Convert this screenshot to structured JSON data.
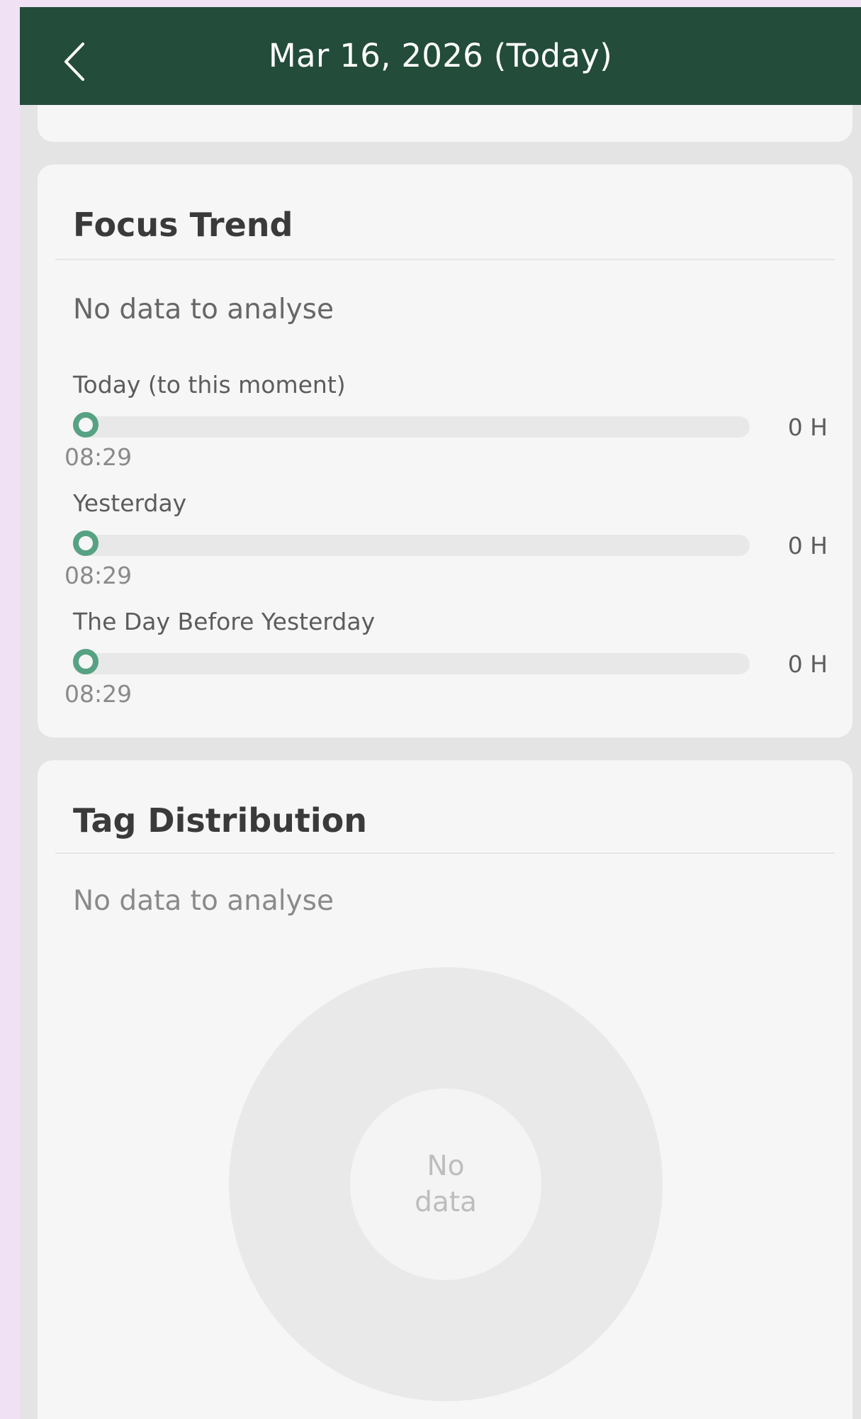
{
  "header": {
    "title": "Mar 16, 2026 (Today)",
    "back_icon": "chevron-left-icon"
  },
  "colors": {
    "header_bg": "#234c3a",
    "accent": "#57a283",
    "card_bg": "#f6f6f6",
    "page_bg": "#e4e4e4"
  },
  "focus_trend": {
    "title": "Focus Trend",
    "empty_text": "No data to analyse",
    "rows": [
      {
        "label": "Today (to this moment)",
        "time": "08:29",
        "value": "0 H",
        "progress": 0
      },
      {
        "label": "Yesterday",
        "time": "08:29",
        "value": "0 H",
        "progress": 0
      },
      {
        "label": "The Day Before Yesterday",
        "time": "08:29",
        "value": "0 H",
        "progress": 0
      }
    ]
  },
  "tag_distribution": {
    "title": "Tag Distribution",
    "empty_text": "No data to analyse",
    "chart_center_text": "No data"
  }
}
